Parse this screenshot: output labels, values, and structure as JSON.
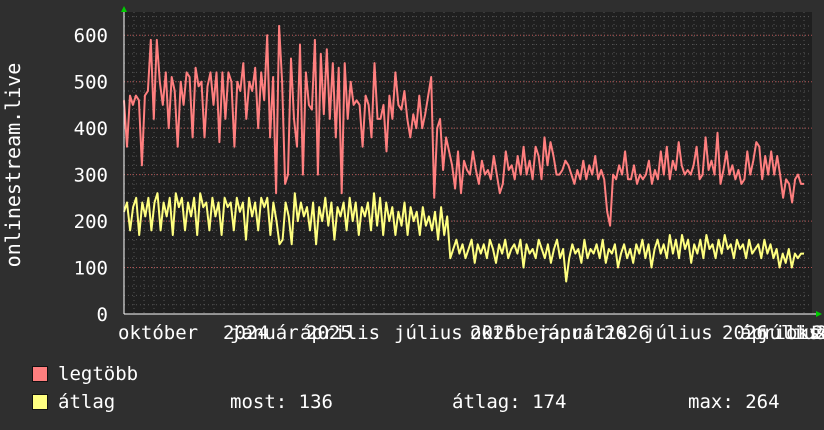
{
  "chart_data": {
    "type": "line",
    "ylabel": "onlinestream.live",
    "ylim": [
      0,
      650
    ],
    "yticks": [
      0,
      100,
      200,
      300,
      400,
      500,
      600
    ],
    "xticks": [
      "október",
      "2024",
      "január",
      "április",
      "2025",
      "július",
      "október",
      "2025",
      "január",
      "április",
      "2026",
      "július",
      "2026",
      "április",
      "július",
      "október",
      "2026",
      "2"
    ],
    "grid": true,
    "series": [
      {
        "name": "legtöbb",
        "color": "#ff7f7f",
        "values": [
          460,
          360,
          470,
          450,
          470,
          460,
          320,
          470,
          480,
          590,
          420,
          590,
          500,
          450,
          520,
          400,
          510,
          480,
          360,
          500,
          450,
          520,
          510,
          380,
          530,
          490,
          500,
          380,
          490,
          520,
          450,
          520,
          370,
          520,
          420,
          520,
          500,
          360,
          500,
          480,
          540,
          420,
          500,
          480,
          530,
          400,
          520,
          460,
          600,
          380,
          510,
          260,
          620,
          500,
          280,
          300,
          550,
          420,
          360,
          580,
          300,
          520,
          450,
          440,
          590,
          300,
          560,
          430,
          570,
          420,
          540,
          380,
          530,
          260,
          540,
          420,
          500,
          450,
          460,
          450,
          360,
          470,
          450,
          380,
          540,
          420,
          420,
          450,
          350,
          470,
          420,
          520,
          450,
          440,
          480,
          420,
          380,
          430,
          400,
          470,
          400,
          430,
          470,
          510,
          250,
          400,
          420,
          310,
          380,
          350,
          320,
          270,
          350,
          260,
          330,
          310,
          300,
          350,
          310,
          280,
          330,
          300,
          310,
          290,
          340,
          300,
          260,
          280,
          350,
          310,
          320,
          290,
          340,
          300,
          360,
          300,
          330,
          290,
          360,
          340,
          290,
          380,
          320,
          370,
          340,
          300,
          300,
          310,
          330,
          320,
          300,
          280,
          310,
          290,
          330,
          290,
          320,
          300,
          340,
          290,
          310,
          290,
          220,
          190,
          300,
          290,
          320,
          300,
          350,
          290,
          290,
          320,
          280,
          300,
          290,
          300,
          330,
          280,
          310,
          290,
          350,
          300,
          360,
          290,
          330,
          310,
          370,
          320,
          300,
          310,
          300,
          320,
          360,
          290,
          300,
          380,
          310,
          330,
          300,
          390,
          280,
          310,
          350,
          300,
          320,
          290,
          310,
          280,
          290,
          350,
          300,
          330,
          370,
          360,
          290,
          340,
          300,
          350,
          300,
          340,
          300,
          250,
          290,
          280,
          240,
          290,
          300,
          280,
          280
        ]
      },
      {
        "name": "átlag",
        "color": "#ffff80",
        "values": [
          220,
          240,
          180,
          230,
          250,
          170,
          240,
          210,
          250,
          180,
          240,
          260,
          180,
          240,
          210,
          250,
          170,
          260,
          230,
          250,
          180,
          240,
          210,
          250,
          170,
          260,
          230,
          240,
          180,
          250,
          210,
          240,
          170,
          250,
          230,
          240,
          180,
          250,
          220,
          240,
          160,
          250,
          210,
          240,
          180,
          250,
          230,
          250,
          170,
          240,
          200,
          150,
          160,
          240,
          210,
          150,
          260,
          200,
          240,
          210,
          230,
          180,
          240,
          150,
          230,
          200,
          250,
          190,
          240,
          160,
          230,
          210,
          240,
          180,
          250,
          200,
          240,
          170,
          230,
          210,
          240,
          180,
          260,
          190,
          250,
          170,
          240,
          200,
          230,
          170,
          220,
          190,
          240,
          170,
          230,
          200,
          220,
          170,
          230,
          190,
          210,
          180,
          220,
          160,
          230,
          170,
          210,
          120,
          140,
          160,
          130,
          150,
          120,
          140,
          160,
          110,
          150,
          130,
          150,
          120,
          160,
          140,
          110,
          150,
          130,
          160,
          120,
          140,
          150,
          130,
          160,
          100,
          150,
          130,
          140,
          120,
          160,
          140,
          120,
          150,
          110,
          140,
          160,
          120,
          140,
          70,
          120,
          150,
          130,
          140,
          110,
          160,
          120,
          140,
          130,
          150,
          120,
          160,
          110,
          140,
          130,
          150,
          100,
          130,
          150,
          120,
          140,
          110,
          150,
          130,
          160,
          120,
          150,
          100,
          140,
          160,
          130,
          150,
          120,
          170,
          130,
          160,
          120,
          170,
          140,
          160,
          110,
          150,
          130,
          160,
          120,
          170,
          140,
          150,
          120,
          160,
          130,
          170,
          140,
          150,
          120,
          160,
          140,
          150,
          120,
          160,
          130,
          140,
          150,
          120,
          160,
          130,
          150,
          120,
          140,
          100,
          130,
          110,
          140,
          100,
          130,
          120,
          130,
          130
        ]
      }
    ]
  },
  "legend": {
    "max_label": "legtöbb",
    "avg_label": "átlag",
    "most": "most: 136",
    "avg": "átlag: 174",
    "max": "max: 264"
  }
}
